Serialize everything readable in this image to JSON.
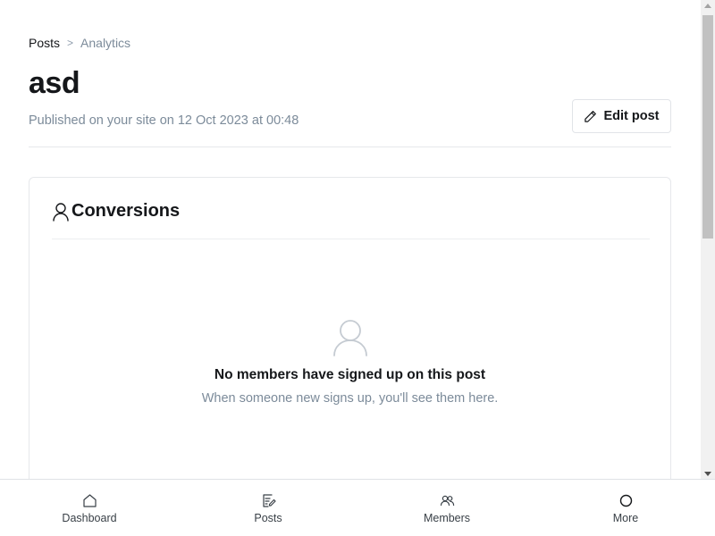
{
  "breadcrumb": {
    "parent": "Posts",
    "separator": ">",
    "current": "Analytics"
  },
  "post": {
    "title": "asd",
    "published": "Published on your site on 12 Oct 2023 at 00:48"
  },
  "actions": {
    "edit_label": "Edit post",
    "edit_icon": "pencil-icon"
  },
  "conversions": {
    "title": "Conversions",
    "title_icon": "user-icon",
    "empty_icon": "user-icon",
    "empty_title": "No members have signed up on this post",
    "empty_subtitle": "When someone new signs up, you'll see them here."
  },
  "bottom_nav": [
    {
      "label": "Dashboard",
      "icon": "home-icon"
    },
    {
      "label": "Posts",
      "icon": "posts-icon"
    },
    {
      "label": "Members",
      "icon": "members-icon"
    },
    {
      "label": "More",
      "icon": "circle-icon"
    }
  ],
  "colors": {
    "text": "#15171a",
    "muted": "#7c8b9a",
    "border": "#e6e8eb"
  }
}
